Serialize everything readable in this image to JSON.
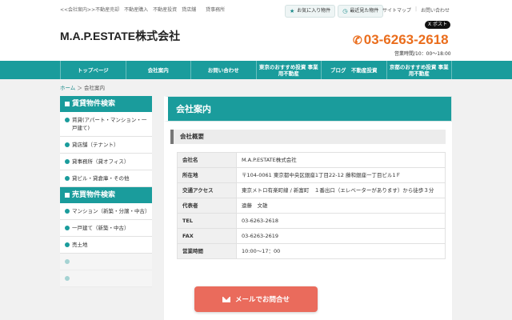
{
  "header": {
    "tagline": "<<会社案内>>不動産売却　不動産購入　不動産投資　貸店舗　　貸事務所",
    "favorites_label": "お気に入り物件",
    "recent_label": "最近見た物件",
    "sitemap_label": "サイトマップ",
    "contact_link_label": "お問い合わせ",
    "logo": "M.A.P.ESTATE株式会社",
    "xpost_label": "X ポスト",
    "tel": "03-6263-2618",
    "hours": "営業時間/10：00〜18:00"
  },
  "nav": {
    "items": [
      {
        "label": "トップページ"
      },
      {
        "label": "会社案内"
      },
      {
        "label": "お問い合わせ"
      },
      {
        "label": "東京のおすすめ投資 事業用不動産"
      },
      {
        "label": "ブログ　不動産投資"
      },
      {
        "label": "京都のおすすめ投資 事業用不動産"
      }
    ]
  },
  "breadcrumb": {
    "home": "ホーム",
    "separator": "＞",
    "current": "会社案内"
  },
  "sidebar": {
    "rental_heading": "賃貸物件検索",
    "rental_items": [
      {
        "label": "賃貸(アパート・マンション・一戸建て)"
      },
      {
        "label": "貸店舗（テナント）"
      },
      {
        "label": "貸事務所（貸オフィス）"
      },
      {
        "label": "貸ビル・貸倉庫・その他"
      }
    ],
    "sale_heading": "売買物件検索",
    "sale_items": [
      {
        "label": "マンション（新築・分譲・中古）"
      },
      {
        "label": "一戸建て（新築・中古）"
      },
      {
        "label": "売土地"
      }
    ]
  },
  "main": {
    "title": "会社案内",
    "section_title": "会社概要",
    "rows": [
      {
        "label": "会社名",
        "value": "M.A.P.ESTATE株式会社"
      },
      {
        "label": "所在地",
        "value": "〒104-0061 東京都中央区銀座1丁目22-12 藤和銀座一丁目ビル1Ｆ"
      },
      {
        "label": "交通アクセス",
        "value": "東京メトロ有楽町線 / 新富町　１番出口（エレベーターがあります）から徒歩３分"
      },
      {
        "label": "代表者",
        "value": "遠藤　文雄"
      },
      {
        "label": "TEL",
        "value": "03-6263-2618"
      },
      {
        "label": "FAX",
        "value": "03-6263-2619"
      },
      {
        "label": "営業時間",
        "value": "10:00〜17：00"
      }
    ]
  },
  "footer_button": {
    "label": "メールでお問合せ"
  },
  "colors": {
    "accent": "#1a9c9c",
    "phone": "#ea6d1c",
    "mail_button": "#ea6b5c"
  }
}
